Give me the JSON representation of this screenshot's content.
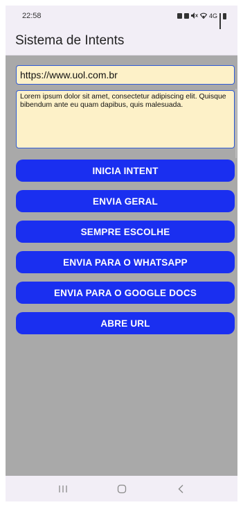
{
  "status_bar": {
    "time": "22:58",
    "network_label": "4G"
  },
  "app_bar": {
    "title": "Sistema de Intents"
  },
  "form": {
    "url_value": "https://www.uol.com.br",
    "message_value": "Lorem ipsum dolor sit amet, consectetur adipiscing elit. Quisque bibendum ante eu quam dapibus, quis malesuada."
  },
  "buttons": [
    {
      "label": "INICIA INTENT"
    },
    {
      "label": "ENVIA GERAL"
    },
    {
      "label": "SEMPRE ESCOLHE"
    },
    {
      "label": "ENVIA PARA O WHATSAPP"
    },
    {
      "label": "ENVIA PARA O GOOGLE DOCS"
    },
    {
      "label": "ABRE URL"
    }
  ],
  "colors": {
    "button_bg": "#1a2ff0",
    "input_bg": "#fdf1c8",
    "input_border": "#2f5bd6",
    "screen_bg": "#a9a9a9",
    "bar_bg": "#f2eef6"
  },
  "nav_bar": {
    "icons": [
      "recent-apps-icon",
      "home-icon",
      "back-icon"
    ]
  }
}
